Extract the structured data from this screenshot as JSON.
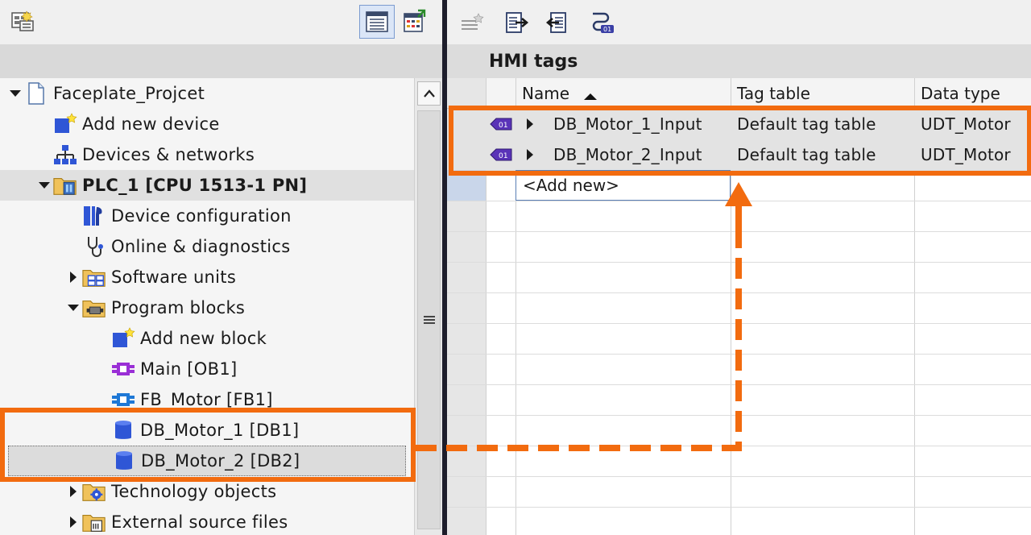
{
  "project_tree": {
    "items": [
      {
        "label": "Faceplate_Projcet",
        "icon": "project-file-icon",
        "expander": "expanded",
        "bold": false
      },
      {
        "label": "Add new device",
        "icon": "add-device-icon",
        "expander": "none",
        "bold": false
      },
      {
        "label": "Devices & networks",
        "icon": "network-icon",
        "expander": "none",
        "bold": false
      },
      {
        "label": "PLC_1 [CPU 1513-1 PN]",
        "icon": "plc-folder-icon",
        "expander": "expanded",
        "bold": true
      },
      {
        "label": "Device configuration",
        "icon": "device-config-icon",
        "expander": "none",
        "bold": false
      },
      {
        "label": "Online & diagnostics",
        "icon": "diagnostics-icon",
        "expander": "none",
        "bold": false
      },
      {
        "label": "Software units",
        "icon": "software-units-folder-icon",
        "expander": "collapsed",
        "bold": false
      },
      {
        "label": "Program blocks",
        "icon": "program-blocks-folder-icon",
        "expander": "expanded",
        "bold": false
      },
      {
        "label": "Add new block",
        "icon": "add-block-icon",
        "expander": "none",
        "bold": false
      },
      {
        "label": "Main [OB1]",
        "icon": "ob-block-icon",
        "expander": "none",
        "bold": false
      },
      {
        "label": "FB_Motor [FB1]",
        "icon": "fb-block-icon",
        "expander": "none",
        "bold": false
      },
      {
        "label": "DB_Motor_1 [DB1]",
        "icon": "db-cylinder-icon",
        "expander": "none",
        "bold": false
      },
      {
        "label": "DB_Motor_2 [DB2]",
        "icon": "db-cylinder-icon",
        "expander": "none",
        "bold": false
      },
      {
        "label": "Technology objects",
        "icon": "technology-folder-icon",
        "expander": "collapsed",
        "bold": false
      },
      {
        "label": "External source files",
        "icon": "external-source-folder-icon",
        "expander": "collapsed",
        "bold": false
      }
    ]
  },
  "hmi_tags": {
    "title": "HMI tags",
    "columns": {
      "name": "Name",
      "tag_table": "Tag table",
      "data_type": "Data type"
    },
    "sort": "ascending",
    "rows": [
      {
        "name": "DB_Motor_1_Input",
        "tag_table": "Default tag table",
        "data_type": "UDT_Motor"
      },
      {
        "name": "DB_Motor_2_Input",
        "tag_table": "Default tag table",
        "data_type": "UDT_Motor"
      }
    ],
    "add_new": "<Add new>"
  },
  "colors": {
    "highlight": "#f26b0f",
    "divider": "#1d1d2b",
    "block_blue": "#3a5bd6",
    "ob_purple": "#8a2be2",
    "folder_yellow": "#e8b84a"
  }
}
